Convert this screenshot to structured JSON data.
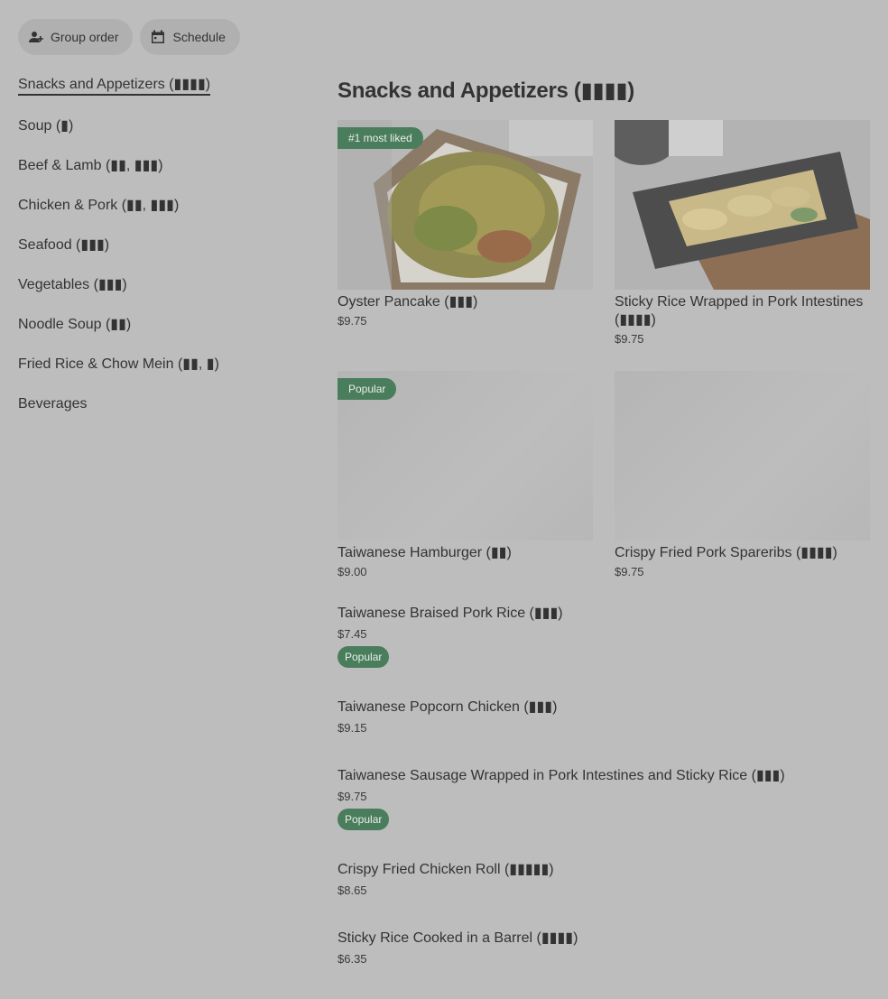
{
  "toolbar": {
    "group_order_label": "Group order",
    "schedule_label": "Schedule"
  },
  "sidebar": {
    "items": [
      {
        "label": "Snacks and Appetizers (▮▮▮▮)"
      },
      {
        "label": "Soup (▮)"
      },
      {
        "label": "Beef & Lamb (▮▮, ▮▮▮)"
      },
      {
        "label": "Chicken & Pork (▮▮, ▮▮▮)"
      },
      {
        "label": "Seafood (▮▮▮)"
      },
      {
        "label": "Vegetables (▮▮▮)"
      },
      {
        "label": "Noodle Soup (▮▮)"
      },
      {
        "label": "Fried Rice & Chow Mein (▮▮, ▮)"
      },
      {
        "label": "Beverages"
      }
    ]
  },
  "section": {
    "title": "Snacks and Appetizers (▮▮▮▮)"
  },
  "cards": [
    {
      "name": "Oyster Pancake (▮▮▮)",
      "price": "$9.75",
      "badge": "#1 most liked"
    },
    {
      "name": "Sticky Rice Wrapped in Pork Intestines (▮▮▮▮)",
      "price": "$9.75",
      "badge": ""
    },
    {
      "name": "Taiwanese Hamburger (▮▮)",
      "price": "$9.00",
      "badge": "Popular"
    },
    {
      "name": "Crispy Fried Pork Sparerib​s  (▮▮▮▮)",
      "price": "$9.75",
      "badge": ""
    }
  ],
  "list": [
    {
      "name": "Taiwanese Braised Pork Rice (▮▮▮)",
      "price": "$7.45",
      "badge": "Popular"
    },
    {
      "name": "Taiwanese Popcorn Chicken (▮▮▮)",
      "price": "$9.15",
      "badge": ""
    },
    {
      "name": "Taiwanese Sausage Wrapped in Pork Intestines and Sticky Rice (▮▮▮)",
      "price": "$9.75",
      "badge": "Popular"
    },
    {
      "name": "Crispy Fried Chicken Roll (▮▮▮▮▮)",
      "price": "$8.65",
      "badge": ""
    },
    {
      "name": "Sticky Rice Cooked in a Barrel (▮▮▮▮)",
      "price": "$6.35",
      "badge": ""
    }
  ]
}
